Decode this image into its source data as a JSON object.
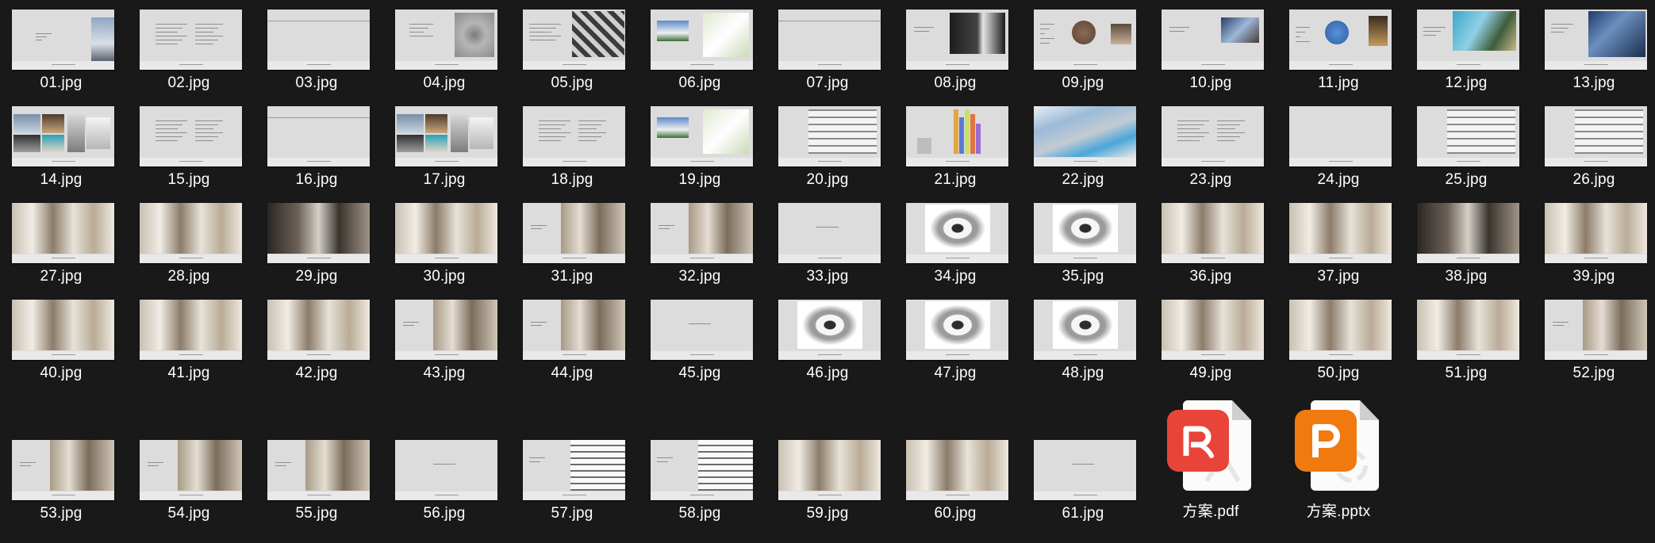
{
  "files": [
    {
      "name": "01.jpg",
      "kind": "image",
      "thumb": "cover"
    },
    {
      "name": "02.jpg",
      "kind": "image",
      "thumb": "text"
    },
    {
      "name": "03.jpg",
      "kind": "image",
      "thumb": "blank-line"
    },
    {
      "name": "04.jpg",
      "kind": "image",
      "thumb": "map"
    },
    {
      "name": "05.jpg",
      "kind": "image",
      "thumb": "aerial"
    },
    {
      "name": "06.jpg",
      "kind": "image",
      "thumb": "site"
    },
    {
      "name": "07.jpg",
      "kind": "image",
      "thumb": "blank-line"
    },
    {
      "name": "08.jpg",
      "kind": "image",
      "thumb": "dark-photo"
    },
    {
      "name": "09.jpg",
      "kind": "image",
      "thumb": "circle"
    },
    {
      "name": "10.jpg",
      "kind": "image",
      "thumb": "photo-small"
    },
    {
      "name": "11.jpg",
      "kind": "image",
      "thumb": "circle-blue"
    },
    {
      "name": "12.jpg",
      "kind": "image",
      "thumb": "photos-pair"
    },
    {
      "name": "13.jpg",
      "kind": "image",
      "thumb": "blue-photo"
    },
    {
      "name": "14.jpg",
      "kind": "image",
      "thumb": "photo-grid"
    },
    {
      "name": "15.jpg",
      "kind": "image",
      "thumb": "text"
    },
    {
      "name": "16.jpg",
      "kind": "image",
      "thumb": "blank-line"
    },
    {
      "name": "17.jpg",
      "kind": "image",
      "thumb": "photo-grid"
    },
    {
      "name": "18.jpg",
      "kind": "image",
      "thumb": "text"
    },
    {
      "name": "19.jpg",
      "kind": "image",
      "thumb": "site"
    },
    {
      "name": "20.jpg",
      "kind": "image",
      "thumb": "plan"
    },
    {
      "name": "21.jpg",
      "kind": "image",
      "thumb": "bars"
    },
    {
      "name": "22.jpg",
      "kind": "image",
      "thumb": "axo"
    },
    {
      "name": "23.jpg",
      "kind": "image",
      "thumb": "text"
    },
    {
      "name": "24.jpg",
      "kind": "image",
      "thumb": "blank"
    },
    {
      "name": "25.jpg",
      "kind": "image",
      "thumb": "plan"
    },
    {
      "name": "26.jpg",
      "kind": "image",
      "thumb": "plan"
    },
    {
      "name": "27.jpg",
      "kind": "image",
      "thumb": "interior"
    },
    {
      "name": "28.jpg",
      "kind": "image",
      "thumb": "interior"
    },
    {
      "name": "29.jpg",
      "kind": "image",
      "thumb": "interior-dark"
    },
    {
      "name": "30.jpg",
      "kind": "image",
      "thumb": "interior"
    },
    {
      "name": "31.jpg",
      "kind": "image",
      "thumb": "interior-half"
    },
    {
      "name": "32.jpg",
      "kind": "image",
      "thumb": "interior-half"
    },
    {
      "name": "33.jpg",
      "kind": "image",
      "thumb": "blank-text"
    },
    {
      "name": "34.jpg",
      "kind": "image",
      "thumb": "plan-center"
    },
    {
      "name": "35.jpg",
      "kind": "image",
      "thumb": "plan-center"
    },
    {
      "name": "36.jpg",
      "kind": "image",
      "thumb": "interior"
    },
    {
      "name": "37.jpg",
      "kind": "image",
      "thumb": "interior"
    },
    {
      "name": "38.jpg",
      "kind": "image",
      "thumb": "interior-dark"
    },
    {
      "name": "39.jpg",
      "kind": "image",
      "thumb": "interior"
    },
    {
      "name": "40.jpg",
      "kind": "image",
      "thumb": "interior"
    },
    {
      "name": "41.jpg",
      "kind": "image",
      "thumb": "interior"
    },
    {
      "name": "42.jpg",
      "kind": "image",
      "thumb": "interior"
    },
    {
      "name": "43.jpg",
      "kind": "image",
      "thumb": "interior-half"
    },
    {
      "name": "44.jpg",
      "kind": "image",
      "thumb": "interior-half"
    },
    {
      "name": "45.jpg",
      "kind": "image",
      "thumb": "blank-text"
    },
    {
      "name": "46.jpg",
      "kind": "image",
      "thumb": "plan-center"
    },
    {
      "name": "47.jpg",
      "kind": "image",
      "thumb": "plan-center"
    },
    {
      "name": "48.jpg",
      "kind": "image",
      "thumb": "plan-center"
    },
    {
      "name": "49.jpg",
      "kind": "image",
      "thumb": "interior"
    },
    {
      "name": "50.jpg",
      "kind": "image",
      "thumb": "interior"
    },
    {
      "name": "51.jpg",
      "kind": "image",
      "thumb": "interior"
    },
    {
      "name": "52.jpg",
      "kind": "image",
      "thumb": "interior-half"
    },
    {
      "name": "53.jpg",
      "kind": "image",
      "thumb": "interior-half"
    },
    {
      "name": "54.jpg",
      "kind": "image",
      "thumb": "interior-half"
    },
    {
      "name": "55.jpg",
      "kind": "image",
      "thumb": "interior-half"
    },
    {
      "name": "56.jpg",
      "kind": "image",
      "thumb": "blank-text"
    },
    {
      "name": "57.jpg",
      "kind": "image",
      "thumb": "plan-right"
    },
    {
      "name": "58.jpg",
      "kind": "image",
      "thumb": "plan-right"
    },
    {
      "name": "59.jpg",
      "kind": "image",
      "thumb": "interior"
    },
    {
      "name": "60.jpg",
      "kind": "image",
      "thumb": "interior"
    },
    {
      "name": "61.jpg",
      "kind": "image",
      "thumb": "blank-text"
    },
    {
      "name": "方案.pdf",
      "kind": "pdf",
      "icon": "pdf-icon",
      "color": "#e8443a"
    },
    {
      "name": "方案.pptx",
      "kind": "pptx",
      "icon": "pptx-icon",
      "color": "#f07a10"
    }
  ]
}
